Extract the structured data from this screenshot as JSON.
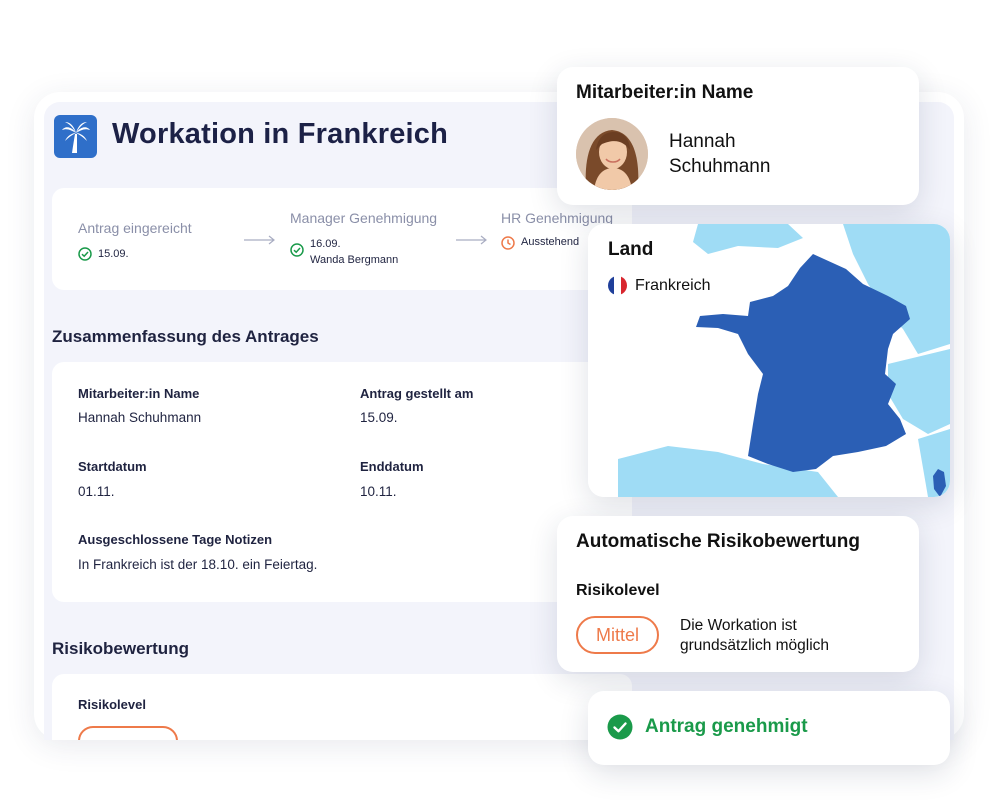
{
  "page": {
    "title": "Workation in Frankreich",
    "logo_icon": "palm-tree-icon"
  },
  "steps": [
    {
      "title": "Antrag eingereicht",
      "status": "done",
      "date": "15.09.",
      "person": ""
    },
    {
      "title": "Manager Genehmigung",
      "status": "done",
      "date": "16.09.",
      "person": "Wanda Bergmann"
    },
    {
      "title": "HR Genehmigung",
      "status": "pending",
      "date": "",
      "person": "",
      "status_text": "Ausstehend"
    }
  ],
  "summary": {
    "heading": "Zusammenfassung des Antrages",
    "fields": {
      "employee_label": "Mitarbeiter:in Name",
      "employee_value": "Hannah Schuhmann",
      "submitted_label": "Antrag gestellt am",
      "submitted_value": "15.09.",
      "start_label": "Startdatum",
      "start_value": "01.11.",
      "end_label": "Enddatum",
      "end_value": "10.11.",
      "notes_label": "Ausgeschlossene Tage Notizen",
      "notes_value": "In Frankreich ist der 18.10. ein Feiertag."
    }
  },
  "risk_section": {
    "heading": "Risikobewertung",
    "level_label": "Risikolevel"
  },
  "employee_card": {
    "title": "Mitarbeiter:in Name",
    "name_first": "Hannah",
    "name_last": "Schuhmann"
  },
  "map_card": {
    "label": "Land",
    "country": "Frankreich"
  },
  "auto_risk_card": {
    "title": "Automatische Risikobewertung",
    "level_label": "Risikolevel",
    "level_value": "Mittel",
    "description": "Die Workation ist grundsätzlich möglich"
  },
  "approval_card": {
    "text": "Antrag genehmigt"
  },
  "colors": {
    "brand_blue": "#2f6fc9",
    "success_green": "#1a9a4a",
    "risk_orange": "#ee7a4a",
    "map_sea_land": "#9fdcf5",
    "map_france": "#2b5fb5"
  }
}
